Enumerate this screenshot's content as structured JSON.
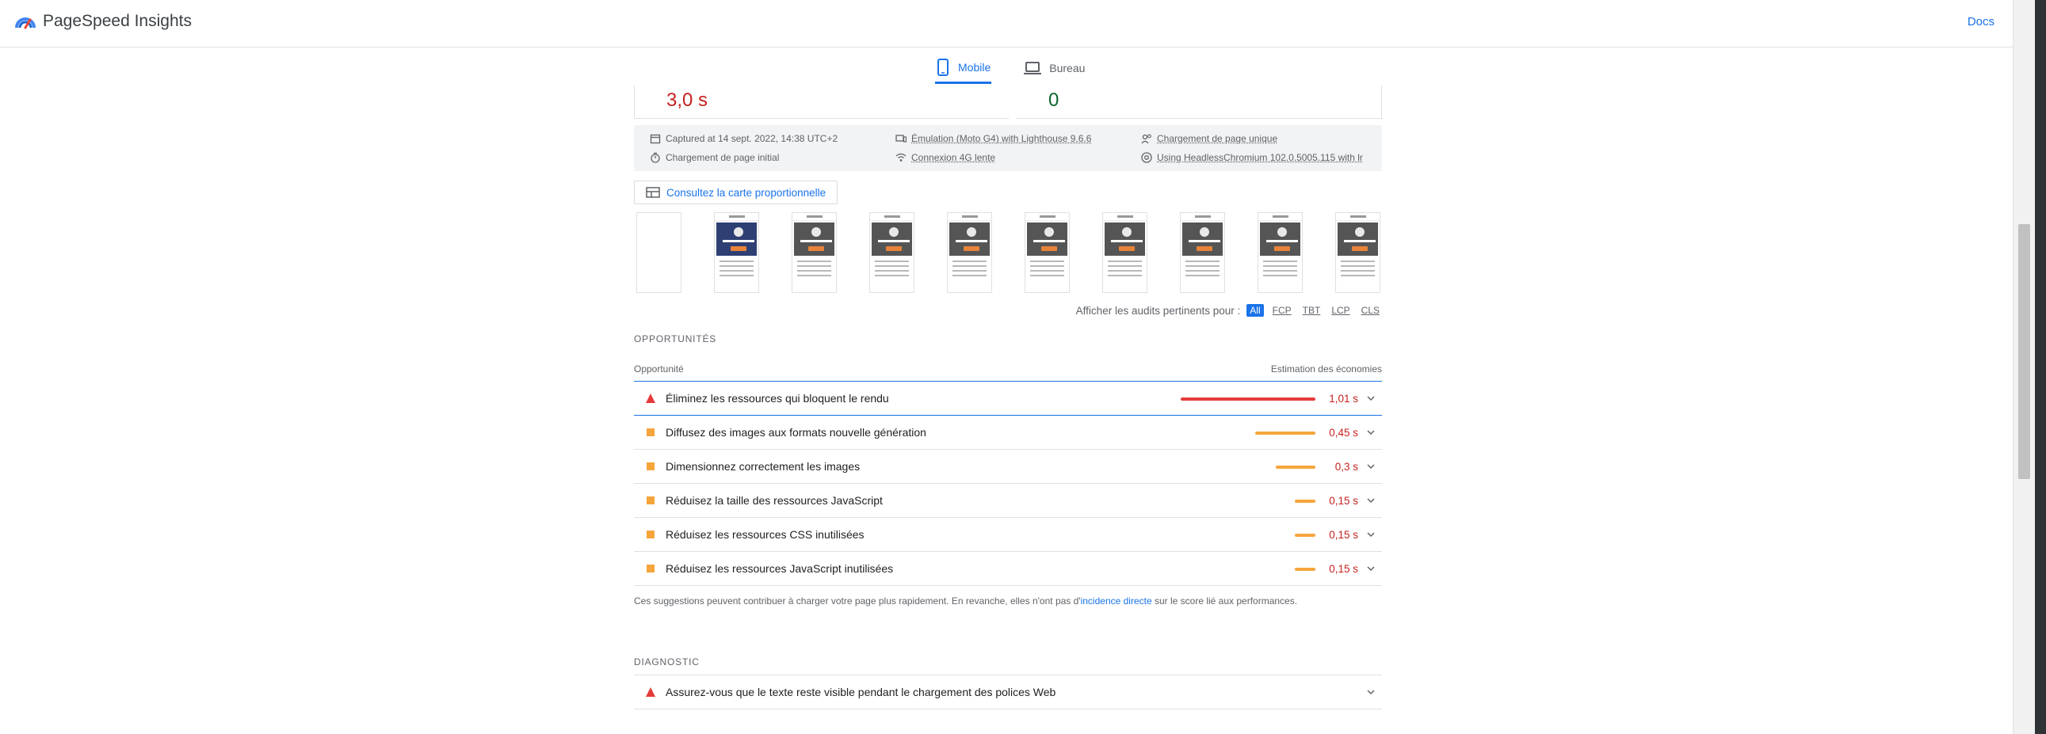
{
  "header": {
    "app_name": "PageSpeed Insights",
    "docs_label": "Docs",
    "logo_icon": "pagespeed-logo-icon"
  },
  "device_tabs": [
    {
      "label": "Mobile",
      "icon": "phone-icon",
      "active": true
    },
    {
      "label": "Bureau",
      "icon": "laptop-icon",
      "active": false
    }
  ],
  "metrics": {
    "left_value": "3,0 s",
    "right_value": "0"
  },
  "runtime": [
    {
      "icon": "calendar-icon",
      "text": "Captured at 14 sept. 2022, 14:38 UTC+2"
    },
    {
      "icon": "device-icon",
      "text": "Émulation (Moto G4) with Lighthouse 9.6.6"
    },
    {
      "icon": "people-icon",
      "text": "Chargement de page unique"
    },
    {
      "icon": "timer-icon",
      "text": "Chargement de page initial"
    },
    {
      "icon": "wifi-icon",
      "text": "Connexion 4G lente"
    },
    {
      "icon": "chrome-icon",
      "text": "Using HeadlessChromium 102.0.5005.115 with lr"
    }
  ],
  "treemap_button": "Consultez la carte proportionnelle",
  "filter": {
    "label": "Afficher les audits pertinents pour :",
    "chips": [
      "All",
      "FCP",
      "TBT",
      "LCP",
      "CLS"
    ],
    "active": "All"
  },
  "opportunities": {
    "section_title": "OPPORTUNITÉS",
    "col_left": "Opportunité",
    "col_right": "Estimation des économies",
    "items": [
      {
        "title": "Éliminez les ressources qui bloquent le rendu",
        "saving": "1,01 s",
        "severity": "fail",
        "saving_seconds": 1.01
      },
      {
        "title": "Diffusez des images aux formats nouvelle génération",
        "saving": "0,45 s",
        "severity": "average",
        "saving_seconds": 0.45
      },
      {
        "title": "Dimensionnez correctement les images",
        "saving": "0,3 s",
        "severity": "average",
        "saving_seconds": 0.3
      },
      {
        "title": "Réduisez la taille des ressources JavaScript",
        "saving": "0,15 s",
        "severity": "average",
        "saving_seconds": 0.15
      },
      {
        "title": "Réduisez les ressources CSS inutilisées",
        "saving": "0,15 s",
        "severity": "average",
        "saving_seconds": 0.15
      },
      {
        "title": "Réduisez les ressources JavaScript inutilisées",
        "saving": "0,15 s",
        "severity": "average",
        "saving_seconds": 0.15
      }
    ],
    "note_before": "Ces suggestions peuvent contribuer à charger votre page plus rapidement. En revanche, elles n'ont pas d'",
    "note_link": "incidence directe",
    "note_after": " sur le score lié aux performances."
  },
  "diagnostic": {
    "section_title": "DIAGNOSTIC",
    "items": [
      {
        "title": "Assurez-vous que le texte reste visible pendant le chargement des polices Web",
        "severity": "fail"
      }
    ]
  },
  "colors": {
    "accent": "#1a73e8",
    "fail": "#e63b3b",
    "average": "#f5a53c",
    "saving_text": "#c5221f",
    "pass": "#0d652d"
  }
}
